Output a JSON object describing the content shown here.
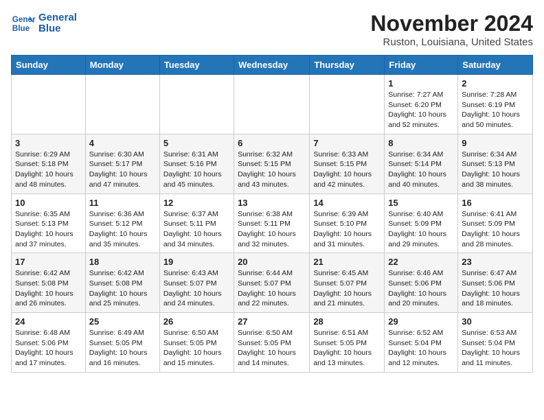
{
  "logo": {
    "line1": "General",
    "line2": "Blue"
  },
  "title": "November 2024",
  "location": "Ruston, Louisiana, United States",
  "weekdays": [
    "Sunday",
    "Monday",
    "Tuesday",
    "Wednesday",
    "Thursday",
    "Friday",
    "Saturday"
  ],
  "weeks": [
    [
      {
        "day": "",
        "info": ""
      },
      {
        "day": "",
        "info": ""
      },
      {
        "day": "",
        "info": ""
      },
      {
        "day": "",
        "info": ""
      },
      {
        "day": "",
        "info": ""
      },
      {
        "day": "1",
        "info": "Sunrise: 7:27 AM\nSunset: 6:20 PM\nDaylight: 10 hours and 52 minutes."
      },
      {
        "day": "2",
        "info": "Sunrise: 7:28 AM\nSunset: 6:19 PM\nDaylight: 10 hours and 50 minutes."
      }
    ],
    [
      {
        "day": "3",
        "info": "Sunrise: 6:29 AM\nSunset: 5:18 PM\nDaylight: 10 hours and 48 minutes."
      },
      {
        "day": "4",
        "info": "Sunrise: 6:30 AM\nSunset: 5:17 PM\nDaylight: 10 hours and 47 minutes."
      },
      {
        "day": "5",
        "info": "Sunrise: 6:31 AM\nSunset: 5:16 PM\nDaylight: 10 hours and 45 minutes."
      },
      {
        "day": "6",
        "info": "Sunrise: 6:32 AM\nSunset: 5:15 PM\nDaylight: 10 hours and 43 minutes."
      },
      {
        "day": "7",
        "info": "Sunrise: 6:33 AM\nSunset: 5:15 PM\nDaylight: 10 hours and 42 minutes."
      },
      {
        "day": "8",
        "info": "Sunrise: 6:34 AM\nSunset: 5:14 PM\nDaylight: 10 hours and 40 minutes."
      },
      {
        "day": "9",
        "info": "Sunrise: 6:34 AM\nSunset: 5:13 PM\nDaylight: 10 hours and 38 minutes."
      }
    ],
    [
      {
        "day": "10",
        "info": "Sunrise: 6:35 AM\nSunset: 5:13 PM\nDaylight: 10 hours and 37 minutes."
      },
      {
        "day": "11",
        "info": "Sunrise: 6:36 AM\nSunset: 5:12 PM\nDaylight: 10 hours and 35 minutes."
      },
      {
        "day": "12",
        "info": "Sunrise: 6:37 AM\nSunset: 5:11 PM\nDaylight: 10 hours and 34 minutes."
      },
      {
        "day": "13",
        "info": "Sunrise: 6:38 AM\nSunset: 5:11 PM\nDaylight: 10 hours and 32 minutes."
      },
      {
        "day": "14",
        "info": "Sunrise: 6:39 AM\nSunset: 5:10 PM\nDaylight: 10 hours and 31 minutes."
      },
      {
        "day": "15",
        "info": "Sunrise: 6:40 AM\nSunset: 5:09 PM\nDaylight: 10 hours and 29 minutes."
      },
      {
        "day": "16",
        "info": "Sunrise: 6:41 AM\nSunset: 5:09 PM\nDaylight: 10 hours and 28 minutes."
      }
    ],
    [
      {
        "day": "17",
        "info": "Sunrise: 6:42 AM\nSunset: 5:08 PM\nDaylight: 10 hours and 26 minutes."
      },
      {
        "day": "18",
        "info": "Sunrise: 6:42 AM\nSunset: 5:08 PM\nDaylight: 10 hours and 25 minutes."
      },
      {
        "day": "19",
        "info": "Sunrise: 6:43 AM\nSunset: 5:07 PM\nDaylight: 10 hours and 24 minutes."
      },
      {
        "day": "20",
        "info": "Sunrise: 6:44 AM\nSunset: 5:07 PM\nDaylight: 10 hours and 22 minutes."
      },
      {
        "day": "21",
        "info": "Sunrise: 6:45 AM\nSunset: 5:07 PM\nDaylight: 10 hours and 21 minutes."
      },
      {
        "day": "22",
        "info": "Sunrise: 6:46 AM\nSunset: 5:06 PM\nDaylight: 10 hours and 20 minutes."
      },
      {
        "day": "23",
        "info": "Sunrise: 6:47 AM\nSunset: 5:06 PM\nDaylight: 10 hours and 18 minutes."
      }
    ],
    [
      {
        "day": "24",
        "info": "Sunrise: 6:48 AM\nSunset: 5:06 PM\nDaylight: 10 hours and 17 minutes."
      },
      {
        "day": "25",
        "info": "Sunrise: 6:49 AM\nSunset: 5:05 PM\nDaylight: 10 hours and 16 minutes."
      },
      {
        "day": "26",
        "info": "Sunrise: 6:50 AM\nSunset: 5:05 PM\nDaylight: 10 hours and 15 minutes."
      },
      {
        "day": "27",
        "info": "Sunrise: 6:50 AM\nSunset: 5:05 PM\nDaylight: 10 hours and 14 minutes."
      },
      {
        "day": "28",
        "info": "Sunrise: 6:51 AM\nSunset: 5:05 PM\nDaylight: 10 hours and 13 minutes."
      },
      {
        "day": "29",
        "info": "Sunrise: 6:52 AM\nSunset: 5:04 PM\nDaylight: 10 hours and 12 minutes."
      },
      {
        "day": "30",
        "info": "Sunrise: 6:53 AM\nSunset: 5:04 PM\nDaylight: 10 hours and 11 minutes."
      }
    ]
  ]
}
